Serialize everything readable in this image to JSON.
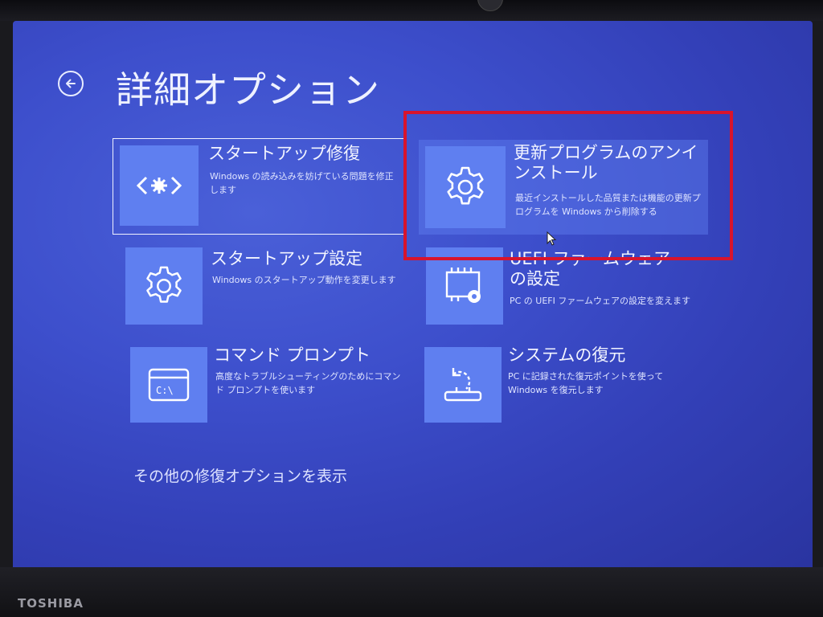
{
  "device": {
    "brand": "TOSHIBA"
  },
  "header": {
    "title": "詳細オプション"
  },
  "tiles": [
    {
      "title": "スタートアップ修復",
      "desc": "Windows の読み込みを妨げている問題を修正します"
    },
    {
      "title": "更新プログラムのアンインストール",
      "desc": "最近インストールした品質または機能の更新プログラムを Windows から削除する"
    },
    {
      "title": "スタートアップ設定",
      "desc": "Windows のスタートアップ動作を変更します"
    },
    {
      "title": "UEFI ファームウェアの設定",
      "desc": "PC の UEFI ファームウェアの設定を変えます"
    },
    {
      "title": "コマンド プロンプト",
      "desc": "高度なトラブルシューティングのためにコマンド プロンプトを使います"
    },
    {
      "title": "システムの復元",
      "desc": "PC に記録された復元ポイントを使って Windows を復元します"
    }
  ],
  "footer": {
    "more_options": "その他の修復オプションを表示"
  },
  "colors": {
    "screen_bg": "#3d4fcc",
    "tile_icon_bg": "#5f7ff0",
    "highlight": "#d8142c"
  }
}
